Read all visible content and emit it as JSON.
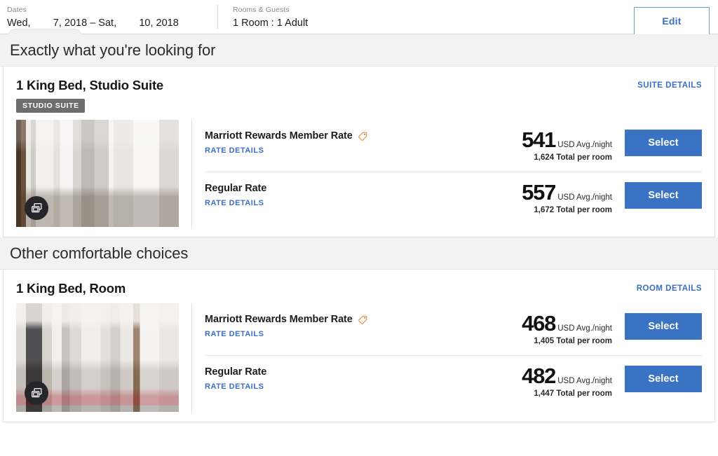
{
  "summary": {
    "dates_label": "Dates",
    "dates_value": "Wed,        7, 2018 – Sat,        10, 2018",
    "guests_label": "Rooms & Guests",
    "guests_value": "1 Room : 1 Adult",
    "edit_label": "Edit"
  },
  "colors": {
    "accent_blue": "#3b73c4",
    "link_blue": "#3b6fc4",
    "badge_gray": "#6d6d6d",
    "tag_orange": "#e08a3c",
    "band_gray": "#f2f2f2"
  },
  "sections": [
    {
      "heading": "Exactly what you're looking for",
      "room": {
        "title": "1 King Bed, Studio Suite",
        "badge": "STUDIO SUITE",
        "details_link": "SUITE DETAILS",
        "photo": "suite-bathroom-photo",
        "gallery_icon": "photo-gallery-icon",
        "rates": [
          {
            "name": "Marriott Rewards Member Rate",
            "has_tag_icon": true,
            "details_link": "RATE DETAILS",
            "amount": "541",
            "unit": "USD Avg./night",
            "total": "1,624 Total per room",
            "select_label": "Select"
          },
          {
            "name": "Regular Rate",
            "has_tag_icon": false,
            "details_link": "RATE DETAILS",
            "amount": "557",
            "unit": "USD Avg./night",
            "total": "1,672 Total per room",
            "select_label": "Select"
          }
        ]
      }
    },
    {
      "heading": "Other comfortable choices",
      "room": {
        "title": "1 King Bed, Room",
        "badge": "",
        "details_link": "ROOM DETAILS",
        "photo": "guest-room-photo",
        "gallery_icon": "photo-gallery-icon",
        "rates": [
          {
            "name": "Marriott Rewards Member Rate",
            "has_tag_icon": true,
            "details_link": "RATE DETAILS",
            "amount": "468",
            "unit": "USD Avg./night",
            "total": "1,405 Total per room",
            "select_label": "Select"
          },
          {
            "name": "Regular Rate",
            "has_tag_icon": false,
            "details_link": "RATE DETAILS",
            "amount": "482",
            "unit": "USD Avg./night",
            "total": "1,447 Total per room",
            "select_label": "Select"
          }
        ]
      }
    }
  ]
}
